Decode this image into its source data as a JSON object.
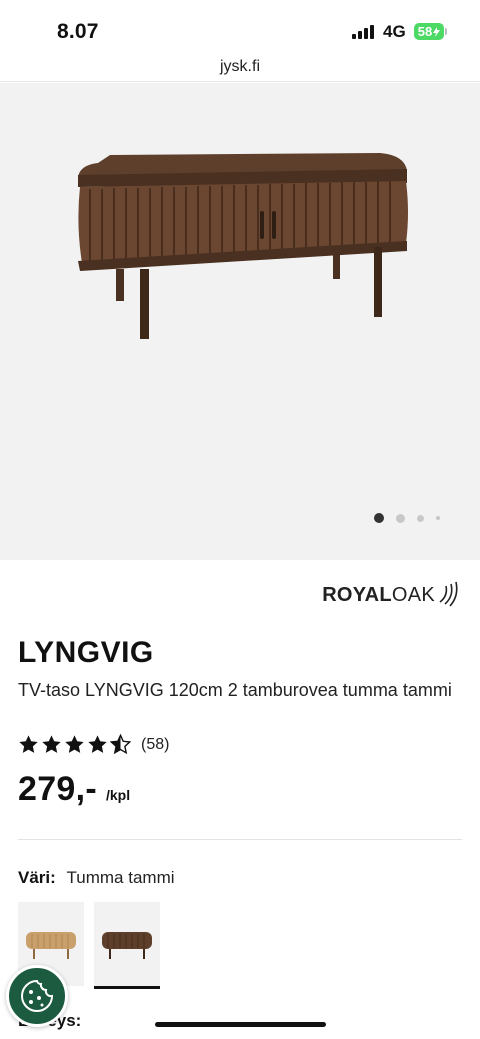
{
  "status_bar": {
    "time": "8.07",
    "network": "4G",
    "battery": "58"
  },
  "browser": {
    "url": "jysk.fi"
  },
  "gallery": {
    "image_icon": "tv-bench-product-image",
    "image_count": 4,
    "active_index": 1
  },
  "product": {
    "brand": {
      "part1": "ROYAL",
      "part2": "OAK"
    },
    "name": "LYNGVIG",
    "description": "TV-taso LYNGVIG 120cm 2 tamburovea tumma tammi",
    "rating": {
      "stars": 4.5,
      "count": "(58)"
    },
    "price": {
      "value": "279,-",
      "unit": "/kpl"
    },
    "color": {
      "label": "Väri:",
      "value": "Tumma tammi",
      "options": [
        "light-oak-swatch",
        "dark-oak-swatch"
      ],
      "selected_index": 1
    },
    "width_label": "Leveys:"
  },
  "colors": {
    "accent_green": "#1d5b41",
    "battery_green": "#4cd964",
    "gallery_bg": "#f2f2f2"
  },
  "icons": {
    "cookie": "cookie-icon",
    "star": "star-icon",
    "signal": "signal-icon"
  }
}
